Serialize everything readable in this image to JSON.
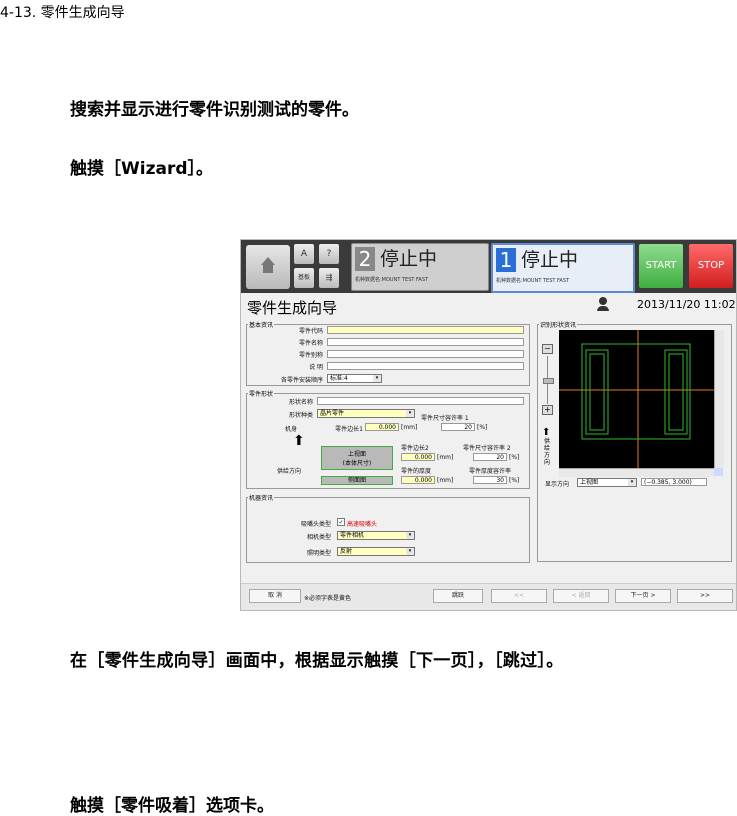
{
  "section_title": "4-13. 零件生成向导",
  "paragraphs": {
    "p1": "搜索并显示进行零件识别测试的零件。",
    "p2": "触摸［Wizard］。",
    "p3": "在［零件生成向导］画面中，根据显示触摸［下一页］，［跳过］。",
    "p4": "触摸［零件吸着］选项卡。"
  },
  "screen": {
    "top": {
      "btn_a": "A",
      "btn_q": "?",
      "btn_c": "基板",
      "status2_num": "2",
      "status2_text": "停止中",
      "status2_sub": "机种数据名:MOUNT TEST FAST",
      "status1_num": "1",
      "status1_text": "停止中",
      "status1_sub": "机种数据名:MOUNT TEST FAST",
      "start": "START",
      "stop": "STOP"
    },
    "title": "零件生成向导",
    "datetime": "2013/11/20 11:02",
    "basic": {
      "group": "基本资讯",
      "part_code": "零件代码",
      "part_name": "零件名称",
      "part_alias": "零件别称",
      "note": "说 明",
      "order_label": "各零件安装顺序",
      "order_value": "标准:4"
    },
    "shape": {
      "group": "零件形状",
      "shape_name": "形状名称",
      "shape_type": "形状种类",
      "shape_type_value": "晶片零件",
      "tol1_label": "零件尺寸容许率 1",
      "body": "机身",
      "side1": "零件边长1",
      "side1_value": "0.000",
      "unit_mm": "[mm]",
      "tol1_value": "20",
      "unit_pct": "[%]",
      "top_view": "上视面",
      "body_size": "(本体尺寸)",
      "side_view": "侧面图",
      "feed_dir": "供给方向",
      "side2": "零件边长2",
      "side2_value": "0.000",
      "tol2_label": "零件尺寸容许率 2",
      "tol2_value": "20",
      "thick": "零件的厚度",
      "thick_value": "0.000",
      "thick_tol_label": "零件厚度容许率",
      "thick_tol_value": "30"
    },
    "machine": {
      "group": "机器资讯",
      "nozzle_label": "吸嘴头类型",
      "nozzle_value": "高速吸嘴头",
      "camera_label": "相机类型",
      "camera_value": "零件相机",
      "light_label": "照明类型",
      "light_value": "反射"
    },
    "recog": {
      "group": "识别形状资讯",
      "feed_vert": "供给方向",
      "view_label": "显示方向",
      "view_value": "上视图",
      "coords": "(−0.385, 3.000)"
    },
    "bottom": {
      "cancel": "取 消",
      "note": "※必须字表是黄色",
      "skip": "跳跃",
      "first": "<<",
      "back": "< 返回",
      "next": "下一页 >",
      "last": ">>"
    }
  }
}
